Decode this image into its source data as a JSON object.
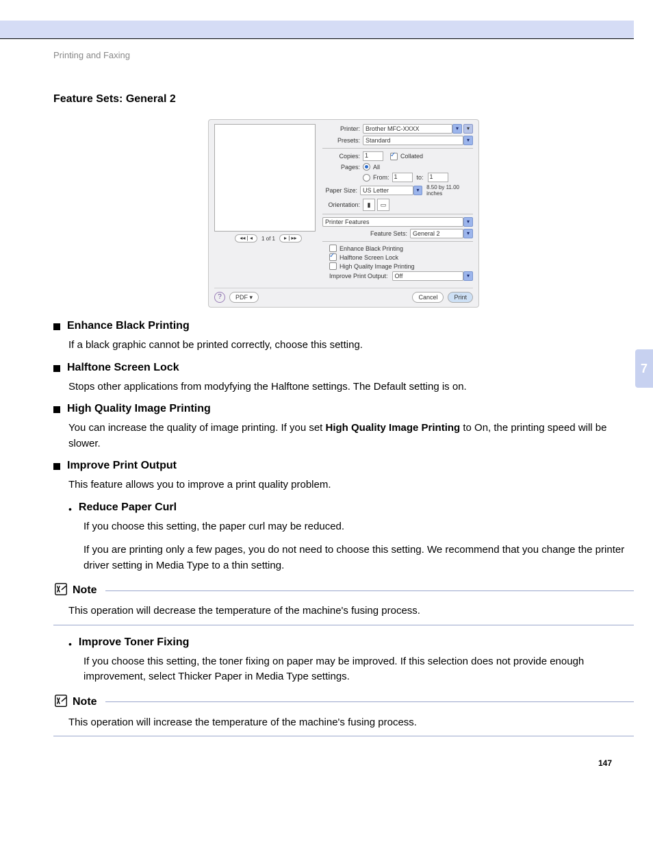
{
  "header": "Printing and Faxing",
  "sectionTitle": "Feature Sets: General 2",
  "sideTab": "7",
  "pageNumber": "147",
  "dialog": {
    "preview": {
      "page_of": "1 of 1",
      "prev": "◂◂ | ◂",
      "next": "▸ | ▸▸"
    },
    "printer": {
      "label": "Printer:",
      "value": "Brother MFC-XXXX"
    },
    "presets": {
      "label": "Presets:",
      "value": "Standard"
    },
    "copies": {
      "label": "Copies:",
      "value": "1",
      "collated": "Collated"
    },
    "pages": {
      "label": "Pages:",
      "all": "All",
      "from_label": "From:",
      "from": "1",
      "to_label": "to:",
      "to": "1"
    },
    "paper": {
      "label": "Paper Size:",
      "value": "US Letter",
      "dims": "8.50 by 11.00 inches"
    },
    "orient": {
      "label": "Orientation:"
    },
    "panel": {
      "value": "Printer Features"
    },
    "featureSets": {
      "label": "Feature Sets:",
      "value": "General 2"
    },
    "opts": {
      "enhance": "Enhance Black Printing",
      "halftone": "Halftone Screen Lock",
      "hq": "High Quality Image Printing",
      "improve_label": "Improve Print Output:",
      "improve_value": "Off"
    },
    "help": "?",
    "pdf": "PDF ▾",
    "cancel": "Cancel",
    "print": "Print"
  },
  "items": {
    "i1": {
      "title": "Enhance Black Printing",
      "body": "If a black graphic cannot be printed correctly, choose this setting."
    },
    "i2": {
      "title": "Halftone Screen Lock",
      "body": "Stops other applications from modyfying the Halftone settings. The Default setting is on."
    },
    "i3": {
      "title": "High Quality Image Printing",
      "body_a": "You can increase the quality of image printing. If you set ",
      "body_bold": "High Quality Image Printing",
      "body_b": " to On, the printing speed will be slower."
    },
    "i4": {
      "title": "Improve Print Output",
      "body": "This feature allows you to improve a print quality problem.",
      "s1": {
        "title": "Reduce Paper Curl",
        "p1": "If you choose this setting, the paper curl may be reduced.",
        "p2a": "If you are printing only a few pages, you do not need to choose this setting. We recommend that you change the printer driver setting in ",
        "p2bold": "Media Type",
        "p2b": " to a thin setting."
      },
      "s2": {
        "title": "Improve Toner Fixing",
        "p1a": "If you choose this setting, the toner fixing on paper may be improved. If this selection does not provide enough improvement, select ",
        "p1bold1": "Thicker Paper",
        "p1mid": " in ",
        "p1bold2": "Media Type",
        "p1b": " settings."
      }
    }
  },
  "notes": {
    "label": "Note",
    "n1": "This operation will decrease the temperature of the machine's fusing process.",
    "n2": "This operation will increase the temperature of the machine's fusing process."
  }
}
